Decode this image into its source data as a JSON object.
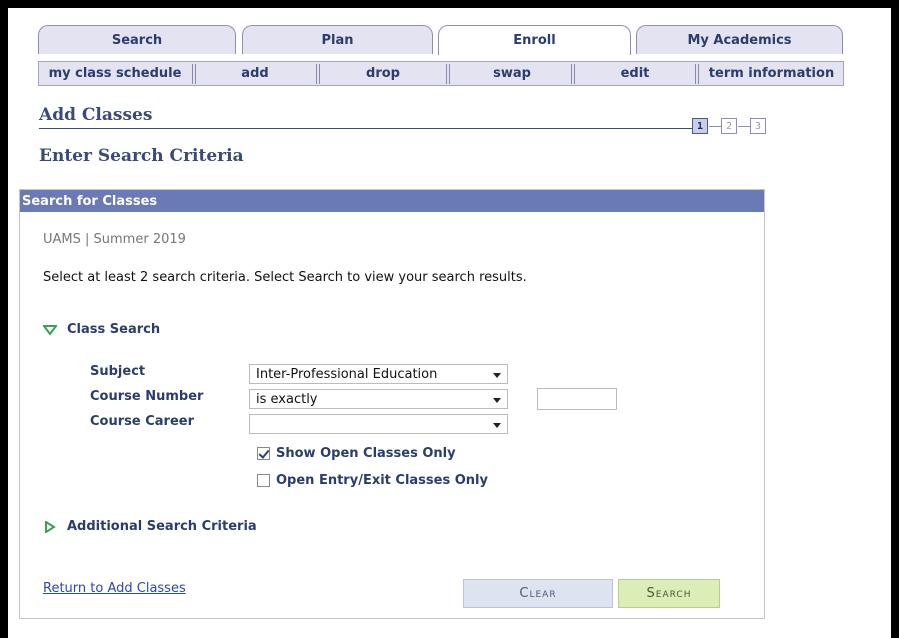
{
  "tabs": [
    {
      "label": "Search",
      "active": false
    },
    {
      "label": "Plan",
      "active": false
    },
    {
      "label": "Enroll",
      "active": true
    },
    {
      "label": "My Academics",
      "active": false
    }
  ],
  "subnav": [
    {
      "label": "my class schedule"
    },
    {
      "label": "add"
    },
    {
      "label": "drop"
    },
    {
      "label": "swap"
    },
    {
      "label": "edit"
    },
    {
      "label": "term information"
    }
  ],
  "page": {
    "title": "Add Classes",
    "subtitle": "Enter Search Criteria",
    "steps": [
      "1",
      "2",
      "3"
    ],
    "current_step": 1
  },
  "panel": {
    "header": "Search for Classes",
    "term": "UAMS | Summer 2019",
    "instructions": "Select at least 2 search criteria. Select Search to view your search results."
  },
  "class_search": {
    "header": "Class Search",
    "expanded": true,
    "subject_label": "Subject",
    "subject_value": "Inter-Professional Education",
    "course_number_label": "Course Number",
    "course_number_operator": "is exactly",
    "course_number_value": "",
    "course_career_label": "Course Career",
    "course_career_value": "",
    "show_open_label": "Show Open Classes Only",
    "show_open_checked": true,
    "open_entry_label": "Open Entry/Exit Classes Only",
    "open_entry_checked": false
  },
  "additional": {
    "header": "Additional Search Criteria",
    "expanded": false
  },
  "footer": {
    "return_link": "Return to Add Classes",
    "clear_button": "Clear",
    "search_button": "Search"
  },
  "colors": {
    "accent": "#6a7ab6",
    "heading": "#3a4a7a",
    "link": "#2848b4",
    "triangle": "#3aa055"
  }
}
